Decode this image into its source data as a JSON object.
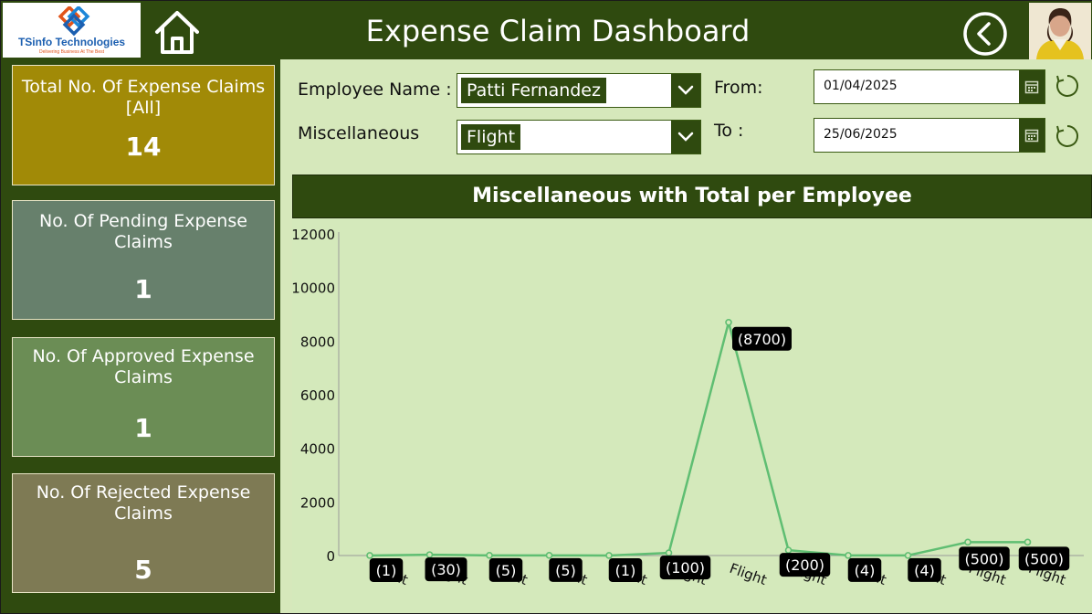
{
  "header": {
    "title": "Expense Claim Dashboard",
    "logo_name": "TSinfo Technologies",
    "logo_tagline": "Delivering Business At The Best"
  },
  "icons": {
    "home": "home-icon",
    "back": "chevron-left-icon",
    "dropdown": "chevron-down-icon",
    "calendar": "calendar-icon",
    "reset": "refresh-icon"
  },
  "sidebar": {
    "cards": [
      {
        "label": "Total No. Of Expense Claims [All]",
        "value": "14",
        "color": "#a18a07"
      },
      {
        "label": "No. Of Pending Expense Claims",
        "value": "1",
        "color": "#67806c"
      },
      {
        "label": "No. Of Approved Expense Claims",
        "value": "1",
        "color": "#6b8d55"
      },
      {
        "label": "No. Of Rejected Expense Claims",
        "value": "5",
        "color": "#7e7a54"
      }
    ]
  },
  "filters": {
    "employee_label": "Employee Name :",
    "employee_value": "Patti Fernandez",
    "misc_label": "Miscellaneous",
    "misc_value": "Flight",
    "from_label": "From:",
    "from_value": "01/04/2025",
    "to_label": "To :",
    "to_value": "25/06/2025"
  },
  "colors": {
    "header_bg": "#2f4a0f",
    "panel_bg": "#d6e8bb",
    "line": "#5fbe72"
  },
  "chart_data": {
    "type": "line",
    "title": "Miscellaneous with Total per Employee",
    "categories": [
      "Flight",
      "Flight",
      "Flight",
      "Flight",
      "Flight",
      "Flight",
      "Flight",
      "Flight",
      "Flight",
      "Flight",
      "Flight",
      "Flight"
    ],
    "series": [
      {
        "values": [
          1,
          30,
          5,
          5,
          1,
          100,
          8700,
          200,
          4,
          4,
          500,
          500
        ]
      }
    ],
    "data_labels": [
      "(1)",
      "(30)",
      "(5)",
      "(5)",
      "(1)",
      "(100)",
      "(8700)",
      "(200)",
      "(4)",
      "(4)",
      "(500)",
      "(500)"
    ],
    "yticks": [
      "0",
      "2000",
      "4000",
      "6000",
      "8000",
      "10000",
      "12000"
    ],
    "ylim": [
      0,
      12000
    ],
    "grid": false
  }
}
